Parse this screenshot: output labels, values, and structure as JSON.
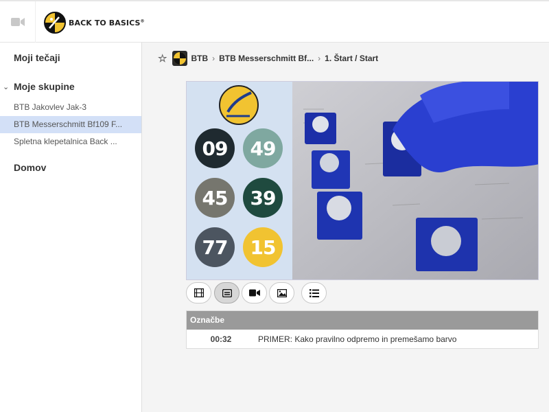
{
  "topbar": {
    "brand_text": "BACK TO BASICS",
    "brand_mark": "®",
    "icons": [
      "video-camera-icon",
      "logo-icon"
    ]
  },
  "sidebar": {
    "my_courses": "Moji tečaji",
    "my_groups": "Moje skupine",
    "groups": [
      {
        "label": "BTB Jakovlev Jak-3",
        "active": false
      },
      {
        "label": "BTB Messerschmitt Bf109 F...",
        "active": true
      },
      {
        "label": "Spletna klepetalnica Back ...",
        "active": false
      }
    ],
    "home": "Domov"
  },
  "breadcrumb": {
    "root": "BTB",
    "course": "BTB Messerschmitt Bf...",
    "lesson": "1. Štart / Start"
  },
  "video": {
    "badges": [
      {
        "label": "09",
        "color": "#1f2a30"
      },
      {
        "label": "49",
        "color": "#7fa8a0"
      },
      {
        "label": "45",
        "color": "#76766e"
      },
      {
        "label": "39",
        "color": "#1f4a3f"
      },
      {
        "label": "77",
        "color": "#4c5560"
      },
      {
        "label": "15",
        "color": "#f1c331"
      }
    ]
  },
  "controls": [
    {
      "name": "film-icon",
      "active": false
    },
    {
      "name": "captions-icon",
      "active": true
    },
    {
      "name": "video-camera-icon",
      "active": false
    },
    {
      "name": "image-icon",
      "active": false
    },
    {
      "name": "list-icon",
      "active": false
    }
  ],
  "markers": {
    "header": "Označbe",
    "rows": [
      {
        "time": "00:32",
        "title": "PRIMER: Kako pravilno odpremo in premešamo barvo"
      }
    ]
  },
  "colors": {
    "active_row": "#d3e0f7",
    "marker_header": "#9a9a9a",
    "brand_yellow": "#f1c331"
  }
}
